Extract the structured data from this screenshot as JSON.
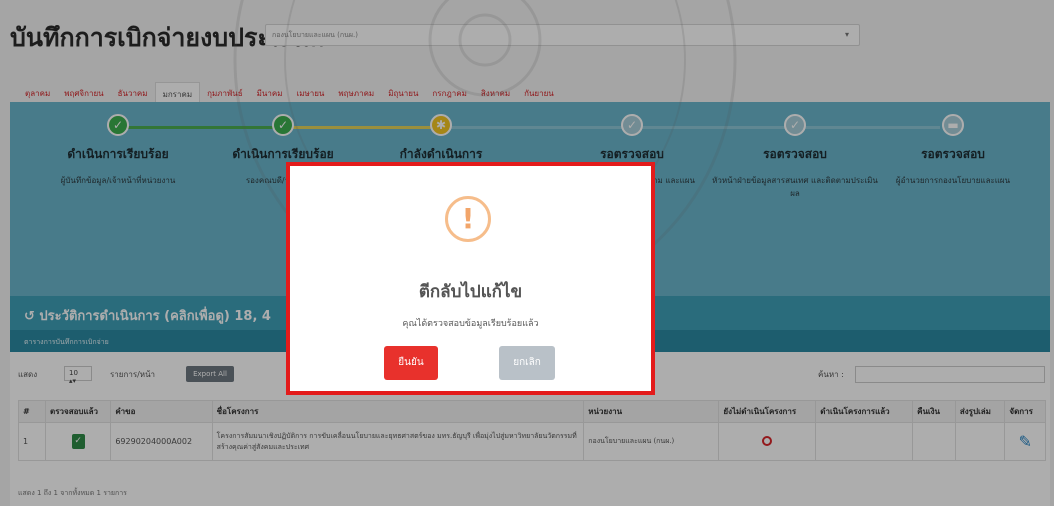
{
  "page": {
    "title": "บันทึกการเบิกจ่ายงบประมาณ",
    "department_value": "กองนโยบายและแผน (กนผ.)"
  },
  "months": [
    "ตุลาคม",
    "พฤศจิกายน",
    "ธันวาคม",
    "มกราคม",
    "กุมภาพันธ์",
    "มีนาคม",
    "เมษายน",
    "พฤษภาคม",
    "มิถุนายน",
    "กรกฎาคม",
    "สิงหาคม",
    "กันยายน"
  ],
  "active_month_index": 3,
  "workflow": {
    "steps": [
      {
        "status": "done",
        "title": "ดำเนินการเรียบร้อย",
        "subtitle": "ผู้บันทึกข้อมูล/เจ้าหน้าที่หน่วยงาน"
      },
      {
        "status": "done",
        "title": "ดำเนินการเรียบร้อย",
        "subtitle": "รองคณบดี/วางแผน/ผู้"
      },
      {
        "status": "current",
        "title": "กำลังดำเนินการ",
        "subtitle": ""
      },
      {
        "status": "wait",
        "title": "รอตรวจสอบ",
        "subtitle": "และติดตาม และแผน"
      },
      {
        "status": "wait",
        "title": "รอตรวจสอบ",
        "subtitle": "หัวหน้าฝ่ายข้อมูลสารสนเทศ และติดตามประเมินผล"
      },
      {
        "status": "wait",
        "title": "รอตรวจสอบ",
        "subtitle": "ผู้อำนวยการกองนโยบายและแผน"
      }
    ]
  },
  "history": {
    "label": "ประวัติการดำเนินการ (คลิกเพื่อดู) 18, 4",
    "subheader": "ตารางการบันทึกการเบิกจ่าย"
  },
  "controls": {
    "show_label": "แสดง",
    "length_value": "10",
    "per_page_label": "รายการ/หน้า",
    "export_label": "Export All",
    "search_label": "ค้นหา :"
  },
  "table": {
    "headers": [
      "#",
      "ตรวจสอบแล้ว",
      "คำขอ",
      "ชื่อโครงการ",
      "หน่วยงาน",
      "ยังไม่ดำเนินโครงการ",
      "ดำเนินโครงการแล้ว",
      "คืนเงิน",
      "ส่งรูปเล่ม",
      "จัดการ"
    ],
    "rows": [
      {
        "num": "1",
        "code": "69290204000A002",
        "project": "โครงการสัมมนาเชิงปฏิบัติการ การขับเคลื่อนนโยบายและยุทธศาสตร์ของ มทร.ธัญบุรี เพื่อมุ่งไปสู่มหาวิทยาลัยนวัตกรรมที่สร้างคุณค่าสู่สังคมและประเทศ",
        "dept": "กองนโยบายและแผน (กนผ.)"
      }
    ],
    "footer": "แสดง 1 ถึง 1 จากทั้งหมด 1 รายการ"
  },
  "modal": {
    "icon": "!",
    "title": "ตีกลับไปแก้ไข",
    "message": "คุณได้ตรวจสอบข้อมูลเรียบร้อยแล้ว",
    "confirm_label": "ยืนยัน",
    "cancel_label": "ยกเลิก"
  },
  "colors": {
    "confirm": "#e8312c",
    "cancel": "#b9c1c8",
    "highlight_border": "#e31b1b",
    "workflow_bg": "#6ab6cc"
  }
}
